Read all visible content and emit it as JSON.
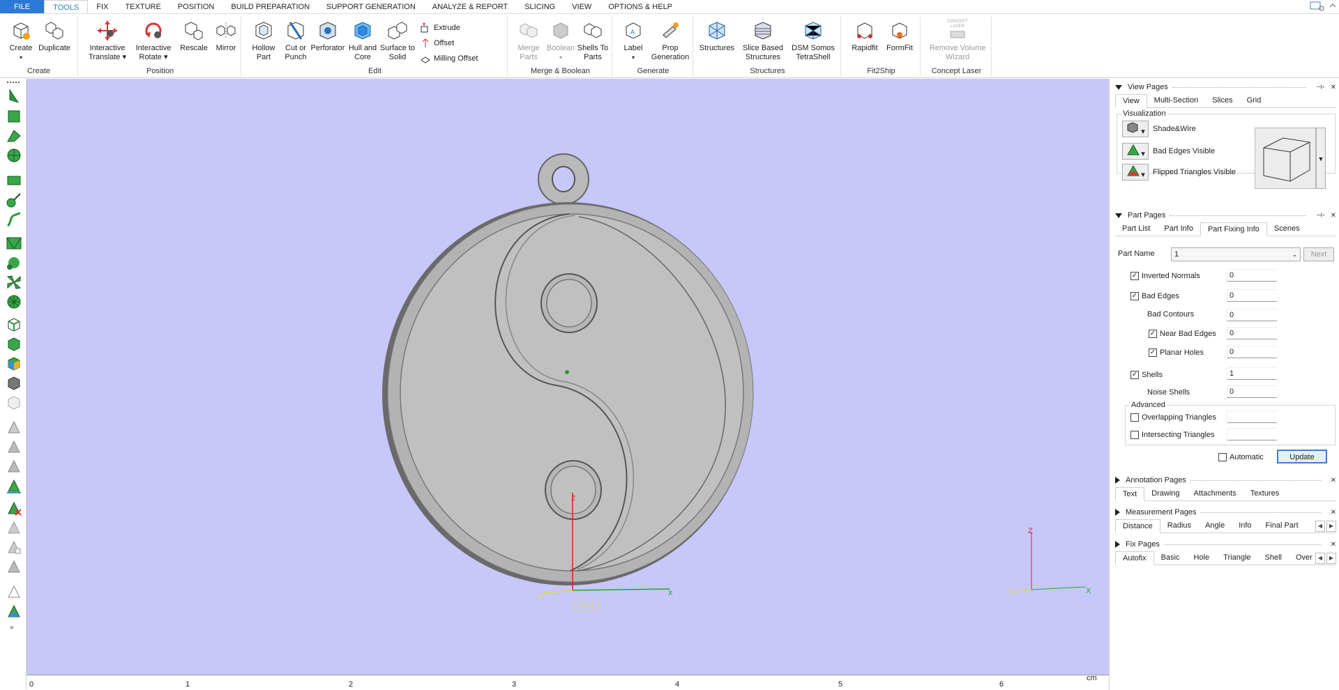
{
  "menu": {
    "items": [
      "FILE",
      "TOOLS",
      "FIX",
      "TEXTURE",
      "POSITION",
      "BUILD PREPARATION",
      "SUPPORT GENERATION",
      "ANALYZE & REPORT",
      "SLICING",
      "VIEW",
      "OPTIONS & HELP"
    ],
    "active": "TOOLS"
  },
  "ribbon": {
    "groups": {
      "create": "Create",
      "position": "Position",
      "edit": "Edit",
      "merge_boolean": "Merge & Boolean",
      "generate": "Generate",
      "structures": "Structures",
      "fit2ship": "Fit2Ship",
      "concept_laser": "Concept Laser"
    },
    "buttons": {
      "create": "Create",
      "duplicate": "Duplicate",
      "interactive_translate": "Interactive Translate",
      "interactive_rotate": "Interactive Rotate",
      "rescale": "Rescale",
      "mirror": "Mirror",
      "hollow_part": "Hollow Part",
      "cut_or_punch": "Cut or Punch",
      "perforator": "Perforator",
      "hull_and_core": "Hull and Core",
      "surface_to_solid": "Surface to Solid",
      "extrude": "Extrude",
      "offset": "Offset",
      "milling_offset": "Milling Offset",
      "merge_parts": "Merge Parts",
      "boolean": "Boolean",
      "shells_to_parts": "Shells To Parts",
      "label": "Label",
      "prop_generation": "Prop Generation",
      "structures": "Structures",
      "slice_based_structures": "Slice Based Structures",
      "dsm_somos_tetrashell": "DSM Somos TetraShell",
      "rapidfit": "Rapidfit",
      "formfit": "FormFit",
      "remove_volume_wizard": "Remove Volume Wizard",
      "concept_laser_logo": "CONCEPT LASER"
    }
  },
  "viewport": {
    "background": "#c7c7f9",
    "ruler_labels": [
      "0",
      "1",
      "2",
      "3",
      "4",
      "5",
      "6"
    ],
    "ruler_unit": "cm",
    "wcs_label": "WCS",
    "axis_labels": {
      "x": "X",
      "y": "Y",
      "z": "Z"
    }
  },
  "panel": {
    "view_pages": {
      "title": "View Pages",
      "tabs": [
        "View",
        "Multi-Section",
        "Slices",
        "Grid"
      ],
      "active_tab": "View",
      "visualization_label": "Visualization",
      "options": [
        "Shade&Wire",
        "Bad Edges Visible",
        "Flipped Triangles Visible"
      ]
    },
    "part_pages": {
      "title": "Part Pages",
      "tabs": [
        "Part List",
        "Part Info",
        "Part Fixing Info",
        "Scenes"
      ],
      "active_tab": "Part Fixing Info",
      "part_name_label": "Part Name",
      "part_name_value": "1",
      "next_label": "Next",
      "rows": [
        {
          "label": "Inverted Normals",
          "checked": true,
          "value": "0"
        },
        {
          "label": "Bad Edges",
          "checked": true,
          "value": "0"
        },
        {
          "label": "Bad Contours",
          "checked": null,
          "value": "0"
        },
        {
          "label": "Near Bad Edges",
          "checked": true,
          "value": "0"
        },
        {
          "label": "Planar Holes",
          "checked": true,
          "value": "0"
        },
        {
          "label": "Shells",
          "checked": true,
          "value": "1"
        },
        {
          "label": "Noise Shells",
          "checked": null,
          "value": "0"
        }
      ],
      "advanced_label": "Advanced",
      "advanced_rows": [
        {
          "label": "Overlapping Triangles",
          "checked": false,
          "value": ""
        },
        {
          "label": "Intersecting Triangles",
          "checked": false,
          "value": ""
        }
      ],
      "automatic_label": "Automatic",
      "update_label": "Update"
    },
    "annotation_pages": {
      "title": "Annotation Pages",
      "tabs": [
        "Text",
        "Drawing",
        "Attachments",
        "Textures"
      ],
      "active_tab": "Text"
    },
    "measurement_pages": {
      "title": "Measurement Pages",
      "tabs": [
        "Distance",
        "Radius",
        "Angle",
        "Info",
        "Final Part"
      ],
      "active_tab": "Distance"
    },
    "fix_pages": {
      "title": "Fix Pages",
      "tabs": [
        "Autofix",
        "Basic",
        "Hole",
        "Triangle",
        "Shell",
        "Over"
      ],
      "active_tab": "Autofix"
    }
  }
}
